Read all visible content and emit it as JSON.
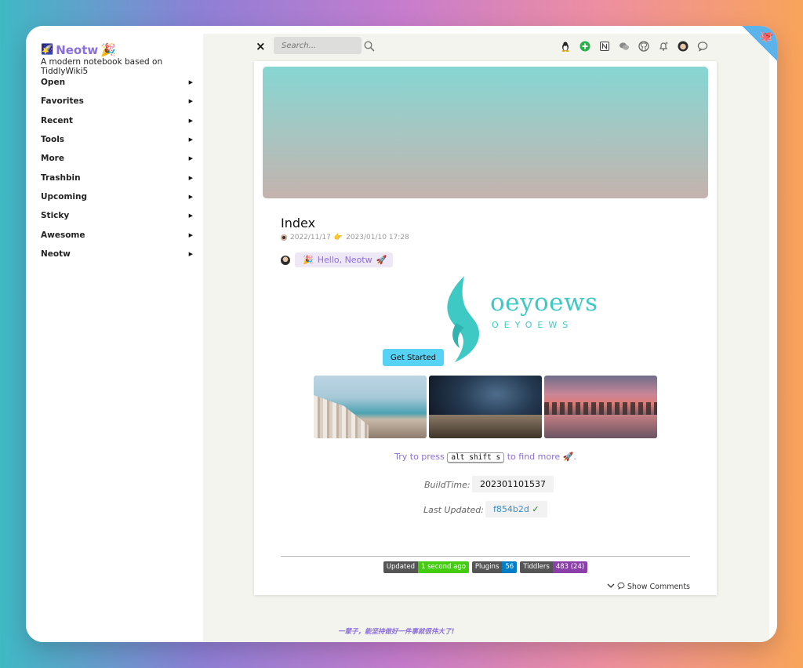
{
  "sidebar": {
    "brand_name": "Neotw",
    "subtitle": "A modern notebook based on TiddlyWiki5",
    "items": [
      {
        "label": "Open"
      },
      {
        "label": "Favorites"
      },
      {
        "label": "Recent"
      },
      {
        "label": "Tools"
      },
      {
        "label": "More"
      },
      {
        "label": "Trashbin"
      },
      {
        "label": "Upcoming"
      },
      {
        "label": "Sticky"
      },
      {
        "label": "Awesome"
      },
      {
        "label": "Neotw"
      }
    ]
  },
  "topbar": {
    "close_glyph": "×",
    "search_placeholder": "Search...",
    "icons": [
      "linux-icon",
      "add-icon",
      "notion-icon",
      "wechat-icon",
      "github-icon",
      "notification-icon",
      "avatar-icon",
      "chat-icon"
    ]
  },
  "tiddler": {
    "title": "Index",
    "created": "2022/11/17",
    "modified": "2023/01/10 17:28",
    "hello_text": "Hello, Neotw",
    "logo_text": "oeyoews",
    "logo_subtext": "OEYOEWS",
    "get_started_label": "Get Started",
    "photos": [
      "coast",
      "night-sky",
      "sunset-lake"
    ],
    "try_prefix": "Try to press",
    "try_keys": "alt shift s",
    "try_suffix": "to find more",
    "build_label": "BuildTime:",
    "build_value": "202301101537",
    "updated_label": "Last Updated:",
    "updated_value": "f854b2d",
    "updated_check": "✓",
    "badges": [
      {
        "key": "Updated",
        "value": "1 second ago",
        "color": "#4c1"
      },
      {
        "key": "Plugins",
        "value": "56",
        "color": "#007ec6"
      },
      {
        "key": "Tiddlers",
        "value": "483 (24)",
        "color": "#8b3fa8"
      }
    ],
    "show_comments": "Show Comments"
  },
  "footer": {
    "quote": "一辈子，能坚持做好一件事就很伟大了!"
  },
  "colors": {
    "accent": "#8b6fd9",
    "logo": "#3ec9c4",
    "button": "#56d2f4",
    "corner": "#5bb3ec"
  }
}
